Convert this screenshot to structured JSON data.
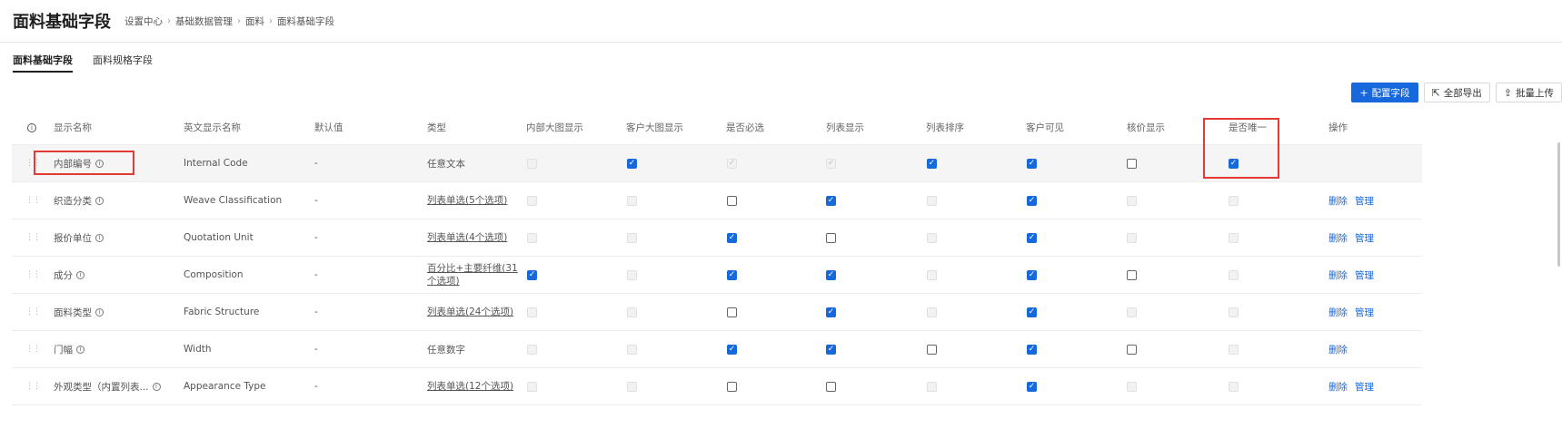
{
  "header": {
    "title": "面料基础字段",
    "breadcrumb": [
      "设置中心",
      "基础数据管理",
      "面料",
      "面料基础字段"
    ]
  },
  "tabs": [
    {
      "label": "面料基础字段",
      "active": true
    },
    {
      "label": "面料规格字段",
      "active": false
    }
  ],
  "toolbar": {
    "config_label": "配置字段",
    "export_label": "全部导出",
    "upload_label": "批量上传"
  },
  "table": {
    "columns": [
      "显示名称",
      "英文显示名称",
      "默认值",
      "类型",
      "内部大图显示",
      "客户大图显示",
      "是否必选",
      "列表显示",
      "列表排序",
      "客户可见",
      "核价显示",
      "是否唯一",
      "操作"
    ],
    "rows": [
      {
        "name": "内部编号",
        "en": "Internal Code",
        "def": "-",
        "type": "任意文本",
        "type_link": false,
        "cbs": [
          [
            "disabled",
            false
          ],
          [
            "enabled",
            true
          ],
          [
            "disabled",
            true
          ],
          [
            "disabled",
            true
          ],
          [
            "enabled",
            true
          ],
          [
            "enabled",
            true
          ],
          [
            "enabled",
            false
          ],
          [
            "enabled",
            true
          ]
        ],
        "actions": []
      },
      {
        "name": "织造分类",
        "en": "Weave Classification",
        "def": "-",
        "type": "列表单选(5个选项)",
        "type_link": true,
        "cbs": [
          [
            "disabled",
            false
          ],
          [
            "disabled",
            false
          ],
          [
            "enabled",
            false
          ],
          [
            "enabled",
            true
          ],
          [
            "disabled",
            false
          ],
          [
            "enabled",
            true
          ],
          [
            "disabled",
            false
          ],
          [
            "disabled",
            false
          ]
        ],
        "actions": [
          "删除",
          "管理"
        ]
      },
      {
        "name": "报价单位",
        "en": "Quotation Unit",
        "def": "-",
        "type": "列表单选(4个选项)",
        "type_link": true,
        "cbs": [
          [
            "disabled",
            false
          ],
          [
            "disabled",
            false
          ],
          [
            "enabled",
            true
          ],
          [
            "enabled",
            false
          ],
          [
            "disabled",
            false
          ],
          [
            "enabled",
            true
          ],
          [
            "disabled",
            false
          ],
          [
            "disabled",
            false
          ]
        ],
        "actions": [
          "删除",
          "管理"
        ]
      },
      {
        "name": "成分",
        "en": "Composition",
        "def": "-",
        "type": "百分比+主要纤维(31个选项)",
        "type_link": true,
        "cbs": [
          [
            "enabled",
            true
          ],
          [
            "disabled",
            false
          ],
          [
            "enabled",
            true
          ],
          [
            "enabled",
            true
          ],
          [
            "disabled",
            false
          ],
          [
            "enabled",
            true
          ],
          [
            "enabled",
            false
          ],
          [
            "disabled",
            false
          ]
        ],
        "actions": [
          "删除",
          "管理"
        ]
      },
      {
        "name": "面料类型",
        "en": "Fabric Structure",
        "def": "-",
        "type": "列表单选(24个选项)",
        "type_link": true,
        "cbs": [
          [
            "disabled",
            false
          ],
          [
            "disabled",
            false
          ],
          [
            "enabled",
            false
          ],
          [
            "enabled",
            true
          ],
          [
            "disabled",
            false
          ],
          [
            "enabled",
            true
          ],
          [
            "disabled",
            false
          ],
          [
            "disabled",
            false
          ]
        ],
        "actions": [
          "删除",
          "管理"
        ]
      },
      {
        "name": "门幅",
        "en": "Width",
        "def": "-",
        "type": "任意数字",
        "type_link": false,
        "cbs": [
          [
            "disabled",
            false
          ],
          [
            "disabled",
            false
          ],
          [
            "enabled",
            true
          ],
          [
            "enabled",
            true
          ],
          [
            "enabled",
            false
          ],
          [
            "enabled",
            true
          ],
          [
            "enabled",
            false
          ],
          [
            "disabled",
            false
          ]
        ],
        "actions": [
          "删除"
        ]
      },
      {
        "name": "外观类型（内置列表...",
        "en": "Appearance Type",
        "def": "-",
        "type": "列表单选(12个选项)",
        "type_link": true,
        "cbs": [
          [
            "disabled",
            false
          ],
          [
            "disabled",
            false
          ],
          [
            "enabled",
            false
          ],
          [
            "enabled",
            false
          ],
          [
            "disabled",
            false
          ],
          [
            "enabled",
            true
          ],
          [
            "disabled",
            false
          ],
          [
            "disabled",
            false
          ]
        ],
        "actions": [
          "删除",
          "管理"
        ]
      }
    ]
  },
  "colors": {
    "primary": "#1668dc",
    "highlight": "#e53935"
  }
}
